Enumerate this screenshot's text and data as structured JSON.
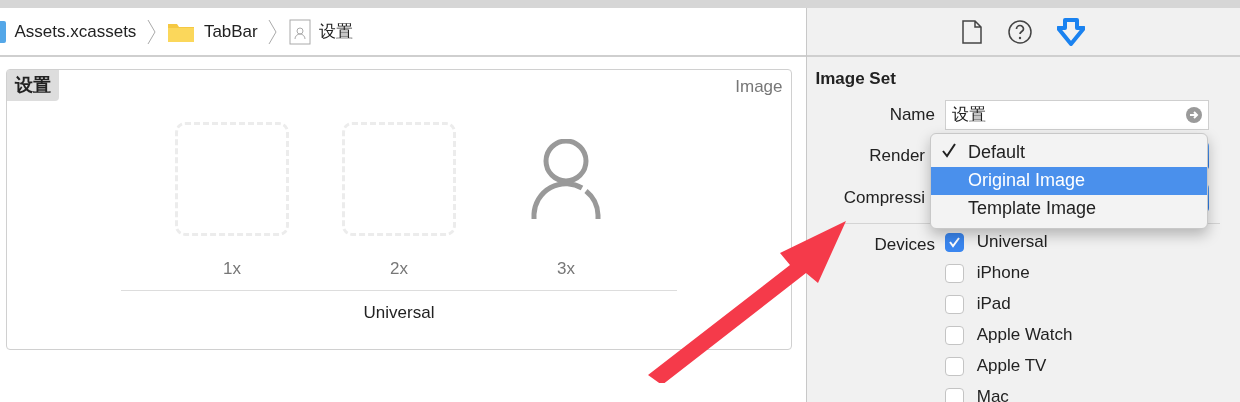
{
  "breadcrumb": [
    {
      "kind": "xcassets",
      "label": "Assets.xcassets"
    },
    {
      "kind": "folder",
      "label": "TabBar"
    },
    {
      "kind": "imageset",
      "label": "设置"
    }
  ],
  "asset": {
    "name": "设置",
    "type_label": "Image",
    "group_label": "Universal",
    "slots": [
      {
        "label": "1x",
        "filled": false
      },
      {
        "label": "2x",
        "filled": false
      },
      {
        "label": "3x",
        "filled": true
      }
    ]
  },
  "inspector": {
    "tabs": [
      {
        "kind": "file",
        "selected": false
      },
      {
        "kind": "help",
        "selected": false
      },
      {
        "kind": "attributes",
        "selected": true
      }
    ],
    "section_title": "Image Set",
    "name_label": "Name",
    "name_value": "设置",
    "render_label": "Render",
    "compression_label": "Compressi",
    "devices_label": "Devices",
    "devices": [
      {
        "label": "Universal",
        "checked": true
      },
      {
        "label": "iPhone",
        "checked": false
      },
      {
        "label": "iPad",
        "checked": false
      },
      {
        "label": "Apple Watch",
        "checked": false
      },
      {
        "label": "Apple TV",
        "checked": false
      },
      {
        "label": "Mac",
        "checked": false
      }
    ]
  },
  "popup": {
    "options": [
      {
        "label": "Default",
        "checked": true,
        "selected": false
      },
      {
        "label": "Original Image",
        "checked": false,
        "selected": true
      },
      {
        "label": "Template Image",
        "checked": false,
        "selected": false
      }
    ]
  }
}
